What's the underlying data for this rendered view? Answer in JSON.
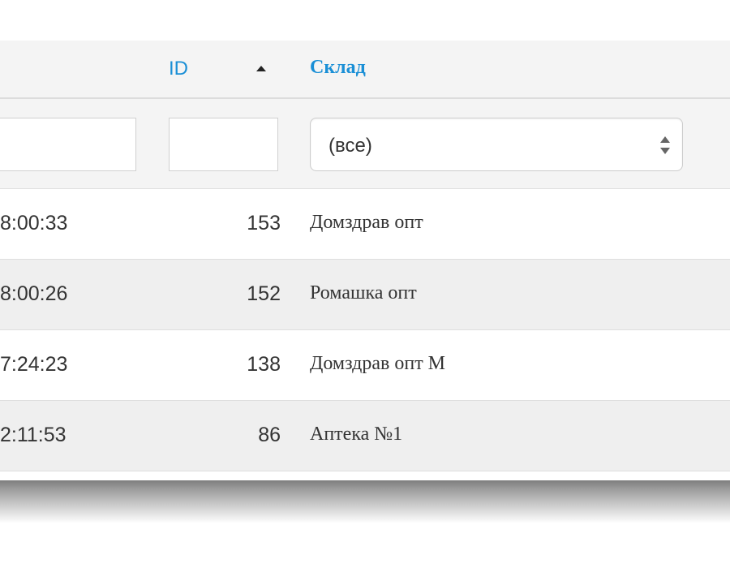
{
  "header": {
    "id_label": "ID",
    "sklad_label": "Склад",
    "sort_icon": "sort-ascending-icon"
  },
  "filters": {
    "date_value": "",
    "id_value": "",
    "sklad_selected": "(все)",
    "select_icon": "select-arrows-icon"
  },
  "rows": [
    {
      "time": "8:00:33",
      "id": "153",
      "sklad": "Домздрав опт"
    },
    {
      "time": "8:00:26",
      "id": "152",
      "sklad": "Ромашка опт"
    },
    {
      "time": "7:24:23",
      "id": "138",
      "sklad": "Домздрав опт М"
    },
    {
      "time": "2:11:53",
      "id": "86",
      "sklad": "Аптека №1"
    }
  ],
  "colors": {
    "link": "#1a8fd6",
    "header_bg": "#f4f4f4",
    "row_alt_bg": "#efefef"
  }
}
